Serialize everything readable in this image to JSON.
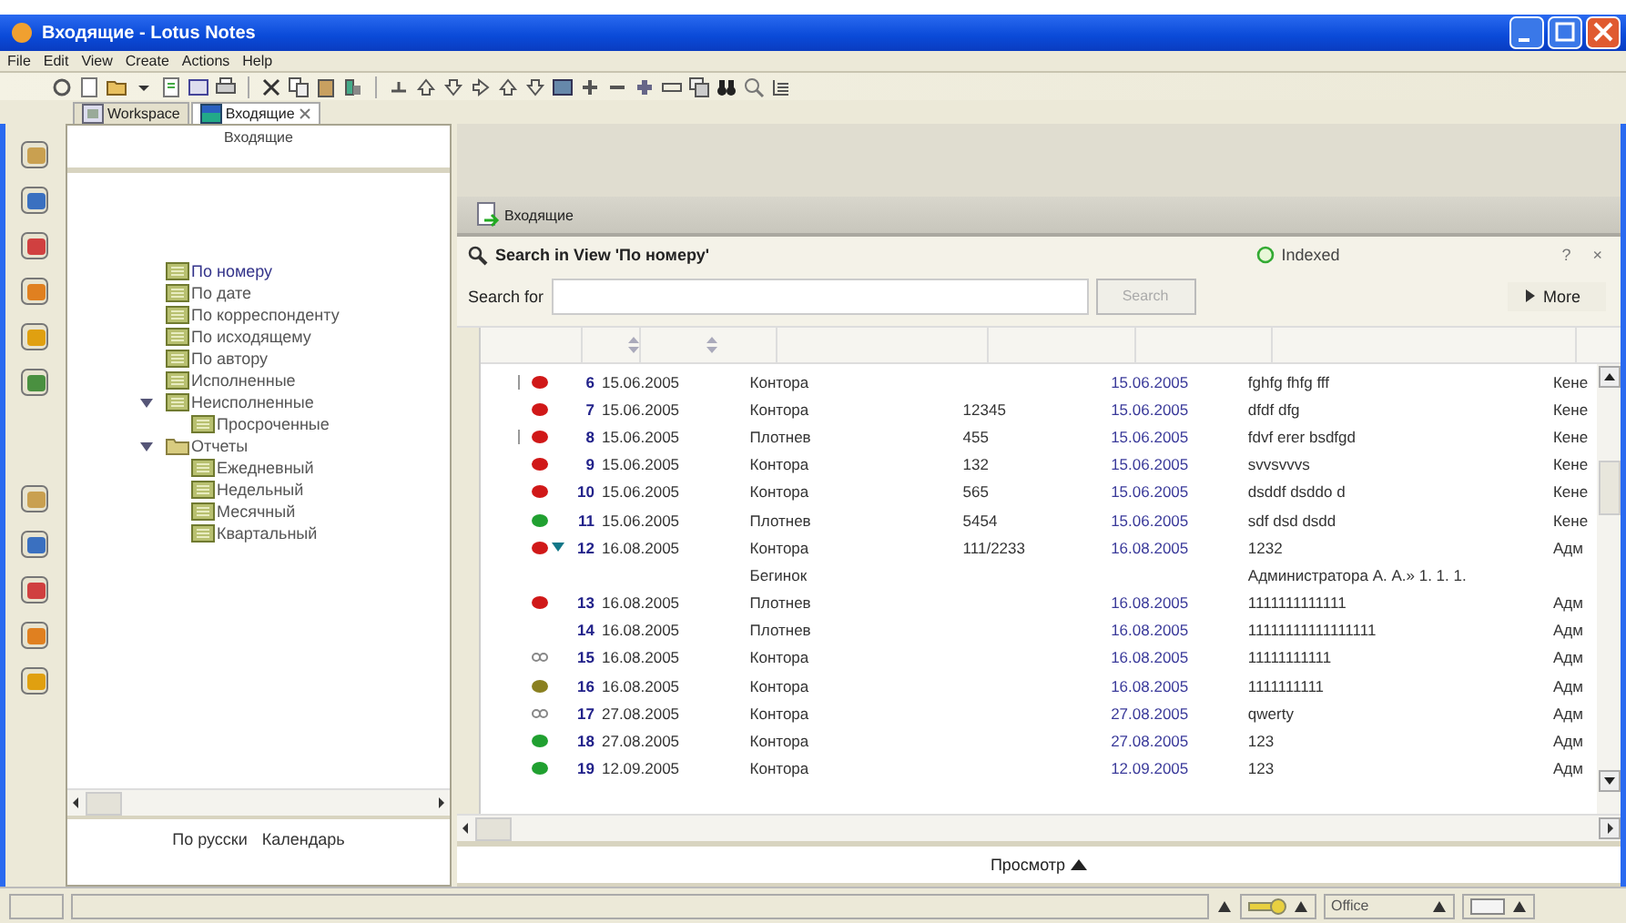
{
  "window": {
    "title": "Входящие - Lotus Notes"
  },
  "menu": [
    "File",
    "Edit",
    "View",
    "Create",
    "Actions",
    "Help"
  ],
  "tabs": [
    {
      "label": "Workspace",
      "selected": false
    },
    {
      "label": "Входящие",
      "selected": true
    }
  ],
  "navigator": {
    "title": "Входящие",
    "items": [
      {
        "label": "По номеру",
        "kind": "view",
        "selected": true
      },
      {
        "label": "По дате",
        "kind": "view",
        "selected": false
      },
      {
        "label": "По корреспонденту",
        "kind": "view",
        "selected": false
      },
      {
        "label": "По исходящему",
        "kind": "view",
        "selected": false
      },
      {
        "label": "По автору",
        "kind": "view",
        "selected": false
      },
      {
        "label": "Исполненные",
        "kind": "view",
        "selected": false
      },
      {
        "label": "Неисполненные",
        "kind": "view",
        "selected": false,
        "expanded": true,
        "children": [
          {
            "label": "Просроченные",
            "kind": "view",
            "selected": false
          }
        ]
      },
      {
        "label": "Отчеты",
        "kind": "folder",
        "selected": false,
        "expanded": true,
        "children": [
          {
            "label": "Ежедневный",
            "kind": "view",
            "selected": false
          },
          {
            "label": "Недельный",
            "kind": "view",
            "selected": false
          },
          {
            "label": "Месячный",
            "kind": "view",
            "selected": false
          },
          {
            "label": "Квартальный",
            "kind": "view",
            "selected": false
          }
        ]
      }
    ],
    "footer": [
      "По русски",
      "Календарь"
    ]
  },
  "view": {
    "title": "Входящие",
    "search": {
      "title": "Search in View 'По номеру'",
      "status": "Indexed",
      "help": "?",
      "close": "×",
      "label": "Search for",
      "button": "Search",
      "disabled": true,
      "more": "More"
    },
    "columns": [
      {
        "sortable": true
      },
      {
        "sortable": true
      },
      {
        "sortable": false
      },
      {
        "sortable": false
      },
      {
        "sortable": false
      },
      {
        "sortable": false
      },
      {
        "sortable": false
      }
    ],
    "rows": [
      {
        "kind": "dot",
        "color": "#d01818",
        "flagged": true,
        "column_1": "6",
        "column_2": "15.06.2005",
        "column_3": "Контора",
        "column_5": "15.06.2005",
        "column_6": "fghfg fhfg fff",
        "column_7": "Кене"
      },
      {
        "kind": "dot",
        "color": "#d01818",
        "flagged": false,
        "column_1": "7",
        "column_2": "15.06.2005",
        "column_3": "Контора",
        "column_4": "12345",
        "column_5": "15.06.2005",
        "column_6": "dfdf dfg",
        "column_7": "Кене"
      },
      {
        "kind": "dot",
        "color": "#d01818",
        "flagged": true,
        "column_1": "8",
        "column_2": "15.06.2005",
        "column_3": "Плотнев",
        "column_4": "455",
        "column_5": "15.06.2005",
        "column_6": "fdvf erer bsdfgd",
        "column_7": "Кене"
      },
      {
        "kind": "dot",
        "color": "#d01818",
        "flagged": false,
        "column_1": "9",
        "column_2": "15.06.2005",
        "column_3": "Контора",
        "column_4": "132",
        "column_5": "15.06.2005",
        "column_6": "svvsvvvs",
        "column_7": "Кене"
      },
      {
        "kind": "dot",
        "color": "#d01818",
        "flagged": false,
        "column_1": "10",
        "column_2": "15.06.2005",
        "column_3": "Контора",
        "column_4": "565",
        "column_5": "15.06.2005",
        "column_6": "dsddf dsddo d",
        "column_7": "Кене"
      },
      {
        "kind": "dot",
        "color": "#20a030",
        "flagged": false,
        "column_1": "11",
        "column_2": "15.06.2005",
        "column_3": "Плотнев",
        "column_4": "5454",
        "column_5": "15.06.2005",
        "column_6": "sdf dsd dsdd",
        "column_7": "Кене"
      },
      {
        "kind": "dot",
        "color": "#d01818",
        "flagged": false,
        "expanded": true,
        "column_1": "12",
        "column_2": "16.08.2005",
        "column_3": "Контора",
        "column_4": "111/2233",
        "column_5": "16.08.2005",
        "column_6": "1232",
        "column_7": "Адм"
      },
      {
        "kind": "response",
        "column_3": "Бегинок",
        "column_6": "Администратора А. А.» 1. 1. 1."
      },
      {
        "kind": "dot",
        "color": "#d01818",
        "flagged": false,
        "column_1": "13",
        "column_2": "16.08.2005",
        "column_3": "Плотнев",
        "column_5": "16.08.2005",
        "column_6": "1111111111111",
        "column_7": "Адм"
      },
      {
        "kind": "plain",
        "flagged": false,
        "column_1": "14",
        "column_2": "16.08.2005",
        "column_3": "Плотнев",
        "column_5": "16.08.2005",
        "column_6": "11111111111111111",
        "column_7": "Адм"
      },
      {
        "kind": "link",
        "flagged": false,
        "column_1": "15",
        "column_2": "16.08.2005",
        "column_3": "Контора",
        "column_5": "16.08.2005",
        "column_6": "11111111111",
        "column_7": "Адм"
      },
      {
        "kind": "dot",
        "color": "#8a8020",
        "flagged": false,
        "column_1": "16",
        "column_2": "16.08.2005",
        "column_3": "Контора",
        "column_5": "16.08.2005",
        "column_6": "1111111111",
        "column_7": "Адм"
      },
      {
        "kind": "link",
        "flagged": false,
        "column_1": "17",
        "column_2": "27.08.2005",
        "column_3": "Контора",
        "column_5": "27.08.2005",
        "column_6": "qwerty",
        "column_7": "Адм"
      },
      {
        "kind": "dot",
        "color": "#20a030",
        "flagged": false,
        "column_1": "18",
        "column_2": "27.08.2005",
        "column_3": "Контора",
        "column_5": "27.08.2005",
        "column_6": "123",
        "column_7": "Адм"
      },
      {
        "kind": "dot",
        "color": "#20a030",
        "flagged": false,
        "column_1": "19",
        "column_2": "12.09.2005",
        "column_3": "Контора",
        "column_5": "12.09.2005",
        "column_6": "123",
        "column_7": "Адм"
      }
    ],
    "preview": "Просмотр"
  },
  "status_bar": {
    "location": "Office"
  }
}
